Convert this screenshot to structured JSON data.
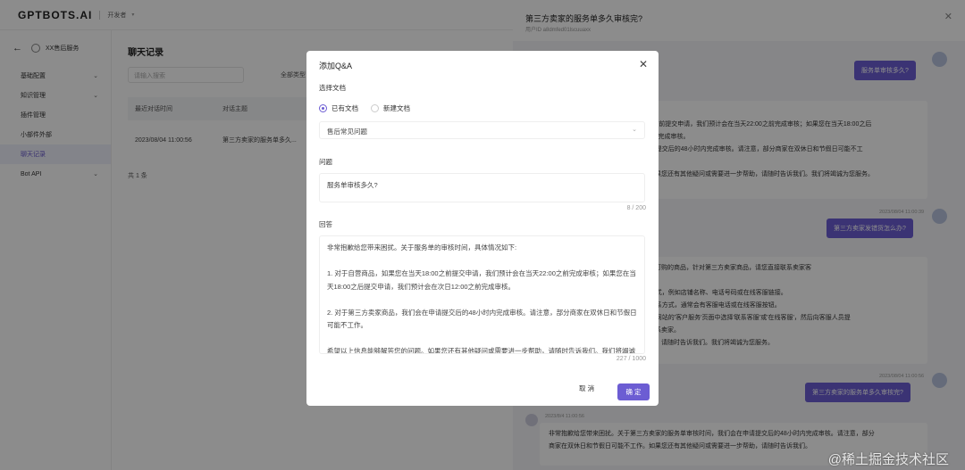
{
  "app": {
    "logo": "GPTBOTS.AI",
    "env": "开发者"
  },
  "sidebar": {
    "bot_name": "XX售后服务",
    "items": [
      {
        "label": "基础配置",
        "has_chevron": true
      },
      {
        "label": "知识管理",
        "has_chevron": true
      },
      {
        "label": "插件管理",
        "has_chevron": false
      },
      {
        "label": "小部件外部",
        "has_chevron": false
      },
      {
        "label": "聊天记录",
        "has_chevron": false,
        "active": true
      },
      {
        "label": "Bot API",
        "has_chevron": true
      }
    ]
  },
  "main": {
    "title": "聊天记录",
    "search_placeholder": "请输入搜索",
    "filter_label": "全部类型",
    "columns": [
      "最近对话时间",
      "对话主题"
    ],
    "rows": [
      {
        "time": "2023/08/04 11:00:56",
        "topic": "第三方卖家的服务单多久..."
      }
    ],
    "total": "共 1 条"
  },
  "drawer": {
    "title": "第三方卖家的服务单多久审核完?",
    "subtitle": "用户ID a8dmfed01lscuuaxx",
    "messages": {
      "user1": "服务单审核多久?",
      "bot1_lines": [
        "售后服务单的审核时间，具体情况如下:",
        "1. 对于自营商品，如果您在当天18:00之前提交申请，我们预计会在当天22:00之前完成审核；如果您在当天18:00之后",
        "提交申请，我们预计会在次日12:00之前完成审核。",
        "2. 对于第三方卖家商品，我们会在申请提交后的48小时内完成审核。请注意，部分商家在双休日和节假日可能不工",
        "作。",
        "希望以上信息能帮助解答您的问题。如果您还有其他疑问或需要进一步帮助，请随时告诉我们。我们将竭诚为您服务。"
      ],
      "ts1": "2023/08/04 11:00:39",
      "user2": "第三方卖家发错货怎么办?",
      "bot2_lines": [
        "您好，如果您收到的商品不是您订单中订购的商品，针对第三方卖家商品，请您直接联系卖家客",
        "服。您可以通过以下方式联系卖家客服:",
        "1. 在订单详情页面中查看卖家的联系方式，例如店铺名称、电话号码或在线客服链接。",
        "2. 在商品详情页面上找到卖家店铺的联系方式，通常会有客服电话或在线客服按钮。",
        "3. 如果找不到卖家的联系方式，请您在网站的'客户服务'页面中选择'联系客服'或'在线客服'，然后向客服人员提",
        "供订单号和具体问题，他们会帮助您联系卖家。",
        "如果您还有其他疑问或需要进一步帮助，请随时告诉我们。我们将竭诚为您服务。"
      ],
      "ts2": "2023/08/04 11:00:56",
      "user3": "第三方卖家的服务单多久审核完?",
      "ts3": "2023/8/4 11:00:56",
      "bot3_lines": [
        "非常抱歉给您带来困扰。关于第三方卖家的服务单审核时间，我们会在申请提交后的48小时内完成审核。请注意，部分",
        "商家在双休日和节假日可能不工作。如果您还有其他疑问或需要进一步帮助，请随时告诉我们。"
      ]
    },
    "watermark": "@稀土掘金技术社区"
  },
  "modal": {
    "title": "添加Q&A",
    "choose_doc_label": "选择文档",
    "radio_existing": "已有文档",
    "radio_new": "新建文档",
    "selected_doc": "售后常见问题",
    "question_label": "问题",
    "question_value": "服务单审核多久?",
    "question_counter": "8 / 200",
    "answer_label": "回答",
    "answer_value": "非常抱歉给您带来困扰。关于服务单的审核时间，具体情况如下:\n\n1. 对于自营商品，如果您在当天18:00之前提交申请，我们预计会在当天22:00之前完成审核；如果您在当天18:00之后提交申请，我们预计会在次日12:00之前完成审核。\n\n2. 对于第三方卖家商品，我们会在申请提交后的48小时内完成审核。请注意，部分商家在双休日和节假日可能不工作。\n\n希望以上信息能够解答您的问题。如果您还有其他疑问或需要进一步帮助，请随时告诉我们。我们将竭诚为您服务。",
    "answer_counter": "227 / 1000",
    "cancel_label": "取 消",
    "ok_label": "确 定"
  }
}
